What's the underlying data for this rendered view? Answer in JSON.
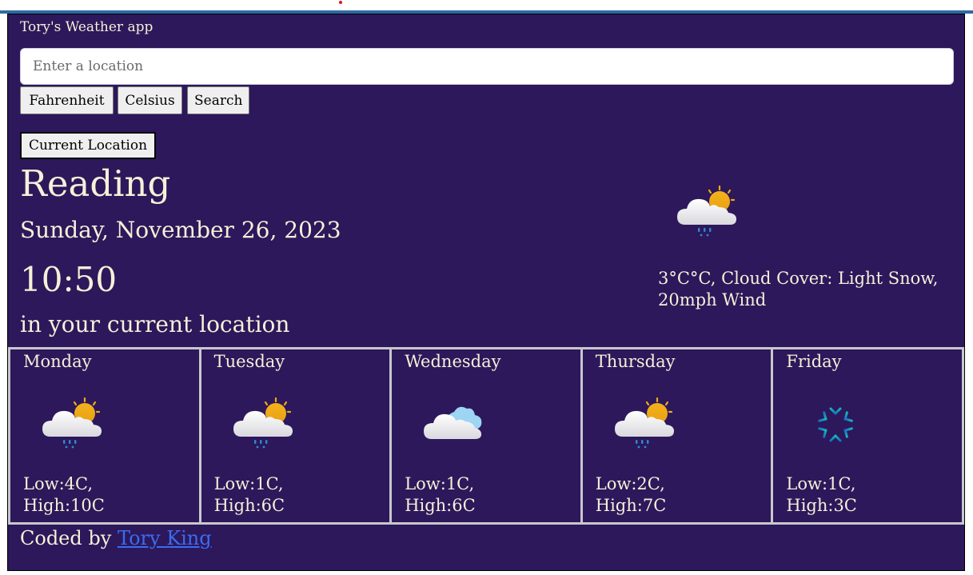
{
  "app": {
    "title": "Tory's Weather app"
  },
  "search": {
    "placeholder": "Enter a location",
    "value": ""
  },
  "buttons": {
    "fahrenheit": "Fahrenheit",
    "celsius": "Celsius",
    "search": "Search",
    "current_location": "Current Location"
  },
  "current": {
    "city": "Reading",
    "date": "Sunday, November 26, 2023",
    "time": "10:50",
    "location_note": "in your current location",
    "icon": "cloud-sun-rain-icon",
    "description": "3°C°C, Cloud Cover: Light Snow, 20mph Wind"
  },
  "forecast": [
    {
      "day": "Monday",
      "icon": "cloud-sun-rain-icon",
      "low": "Low:4C,",
      "high": "High:10C"
    },
    {
      "day": "Tuesday",
      "icon": "cloud-sun-rain-icon",
      "low": "Low:1C,",
      "high": "High:6C"
    },
    {
      "day": "Wednesday",
      "icon": "cloud-icon",
      "low": "Low:1C,",
      "high": "High:6C"
    },
    {
      "day": "Thursday",
      "icon": "cloud-sun-rain-icon",
      "low": "Low:2C,",
      "high": "High:7C"
    },
    {
      "day": "Friday",
      "icon": "snowflake-icon",
      "low": "Low:1C,",
      "high": "High:3C"
    }
  ],
  "footer": {
    "prefix": "Coded by",
    "author_link": "Tory King"
  },
  "colors": {
    "background": "#2c185b",
    "text": "#f6f0d8",
    "link": "#3b6cf0",
    "card_border": "#c8c8cc",
    "topbar": "#2f6aa5"
  }
}
